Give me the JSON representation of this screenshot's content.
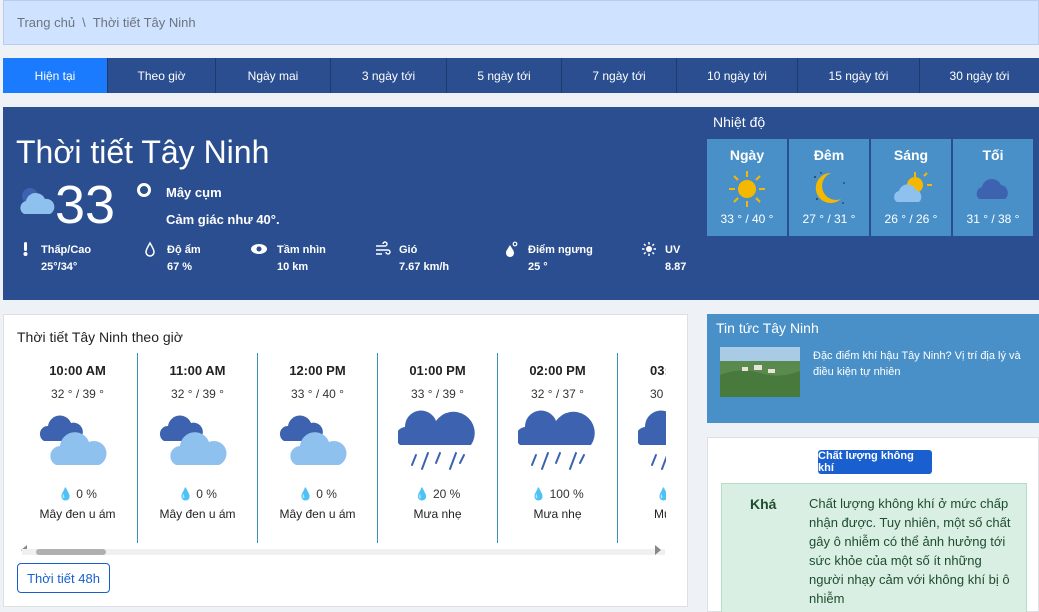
{
  "breadcrumb": {
    "home": "Trang chủ",
    "separator": "\\",
    "current": "Thời tiết Tây Ninh"
  },
  "tabs": [
    "Hiện tại",
    "Theo giờ",
    "Ngày mai",
    "3 ngày tới",
    "5 ngày tới",
    "7 ngày tới",
    "10 ngày tới",
    "15 ngày tới",
    "30 ngày tới"
  ],
  "current": {
    "title": "Thời tiết Tây Ninh",
    "temp": "33",
    "description": "Mây cụm",
    "feels_like": "Cảm giác như 40°.",
    "metrics": [
      {
        "icon": "thermometer-icon",
        "label": "Thấp/Cao",
        "value": "25°/34°"
      },
      {
        "icon": "humidity-drop-icon",
        "label": "Độ ẩm",
        "value": "67 %"
      },
      {
        "icon": "eye-icon",
        "label": "Tầm nhìn",
        "value": "10 km"
      },
      {
        "icon": "wind-icon",
        "label": "Gió",
        "value": "7.67 km/h"
      },
      {
        "icon": "dew-point-icon",
        "label": "Điểm ngưng",
        "value": "25 °"
      },
      {
        "icon": "sun-uv-icon",
        "label": "UV",
        "value": "8.87"
      }
    ]
  },
  "temperature": {
    "heading": "Nhiệt độ",
    "periods": [
      {
        "name": "Ngày",
        "range": "33 ° / 40 °",
        "icon": "sun-icon"
      },
      {
        "name": "Đêm",
        "range": "27 ° / 31 °",
        "icon": "moon-icon"
      },
      {
        "name": "Sáng",
        "range": "26 ° / 26 °",
        "icon": "partly-cloudy-icon"
      },
      {
        "name": "Tối",
        "range": "31 ° / 38 °",
        "icon": "cloud-icon"
      }
    ]
  },
  "hourly": {
    "title": "Thời tiết Tây Ninh theo giờ",
    "items": [
      {
        "time": "10:00 AM",
        "range": "32 ° / 39 °",
        "precip": "0 %",
        "desc": "Mây đen u ám",
        "icon": "overcast-clouds-icon"
      },
      {
        "time": "11:00 AM",
        "range": "32 ° / 39 °",
        "precip": "0 %",
        "desc": "Mây đen u ám",
        "icon": "overcast-clouds-icon"
      },
      {
        "time": "12:00 PM",
        "range": "33 ° / 40 °",
        "precip": "0 %",
        "desc": "Mây đen u ám",
        "icon": "overcast-clouds-icon"
      },
      {
        "time": "01:00 PM",
        "range": "33 ° / 39 °",
        "precip": "20 %",
        "desc": "Mưa nhẹ",
        "icon": "light-rain-icon"
      },
      {
        "time": "02:00 PM",
        "range": "32 ° / 37 °",
        "precip": "100 %",
        "desc": "Mưa nhẹ",
        "icon": "light-rain-icon"
      },
      {
        "time": "03:",
        "range": "30",
        "precip": "",
        "desc": "Mư",
        "icon": "light-rain-icon"
      }
    ],
    "button": "Thời tiết 48h"
  },
  "news": {
    "title": "Tin tức Tây Ninh",
    "link": "Đặc điểm khí hậu Tây Ninh? Vị trí địa lý và điều kiện tự nhiên"
  },
  "air_quality": {
    "badge": "Chất lượng không khí",
    "level": "Khá",
    "text": "Chất lượng không khí ở mức chấp nhận được. Tuy nhiên, một số chất gây ô nhiễm có thể ảnh hưởng tới sức khỏe của một số ít những người nhạy cảm với không khí bị ô nhiễm"
  },
  "colors": {
    "header": "#2a4e8f",
    "tab_active": "#1a7bff",
    "box": "#4a90c8",
    "breadcrumb_bg": "#cfe2ff"
  }
}
